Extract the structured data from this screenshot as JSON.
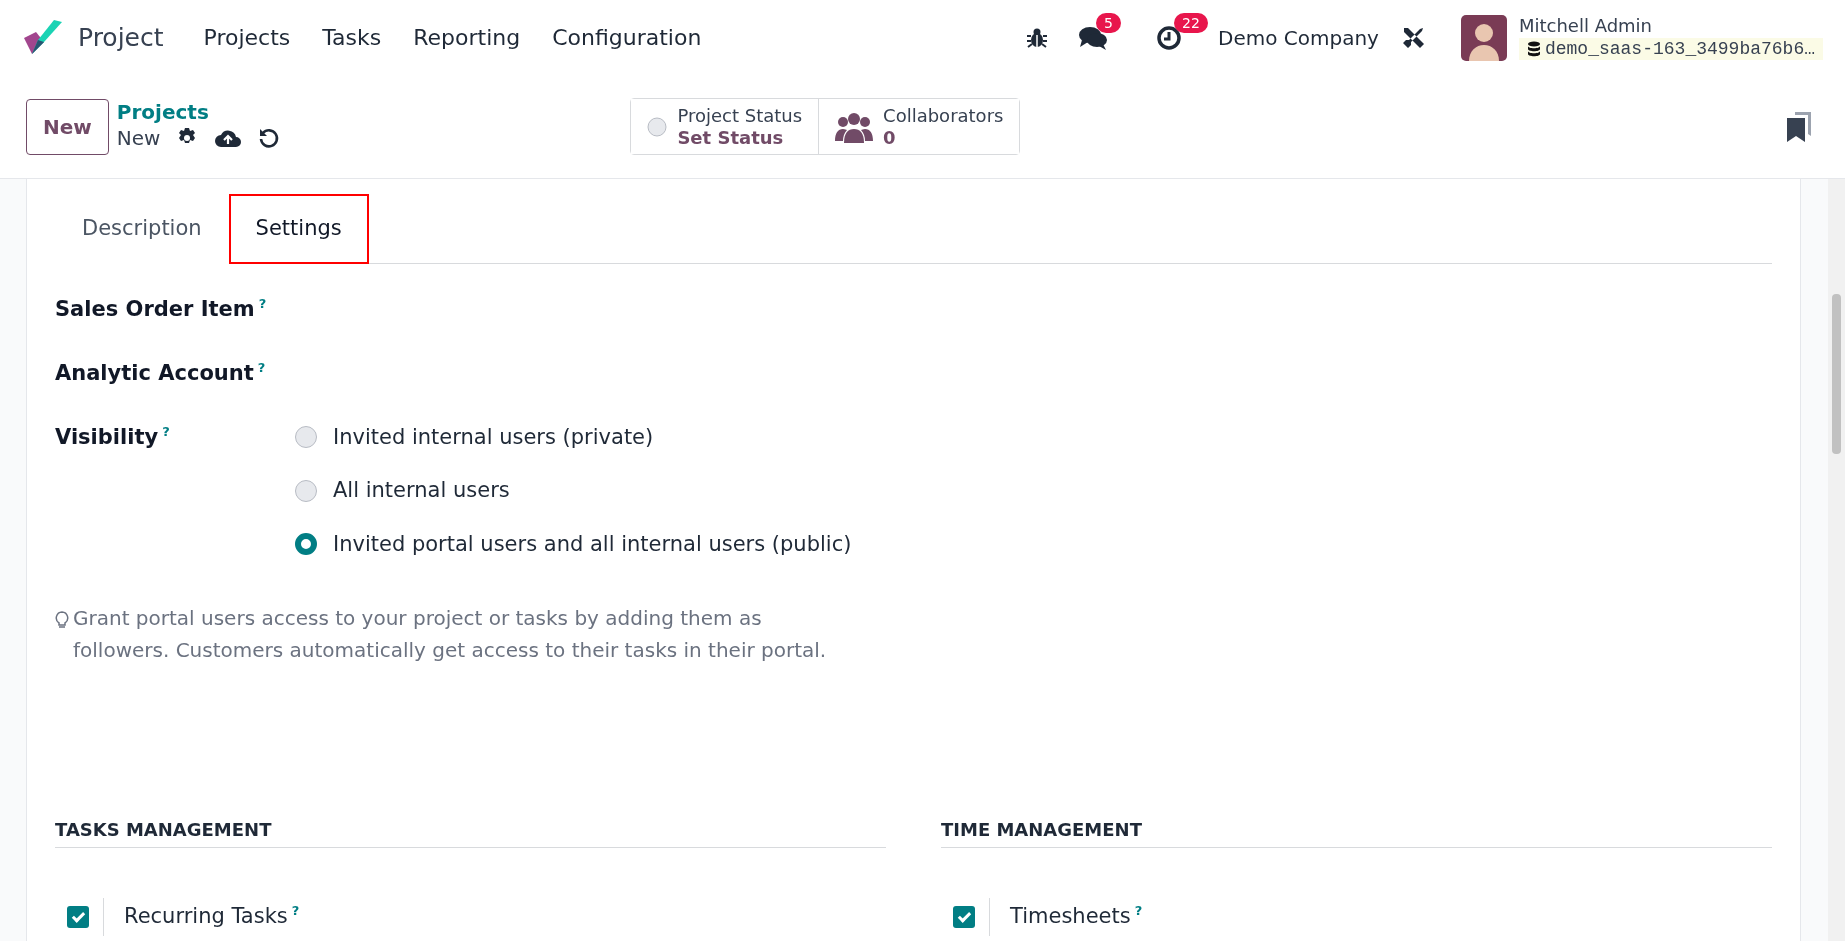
{
  "navbar": {
    "app_name": "Project",
    "menu": [
      {
        "label": "Projects"
      },
      {
        "label": "Tasks"
      },
      {
        "label": "Reporting"
      },
      {
        "label": "Configuration"
      }
    ],
    "messages_badge": "5",
    "activities_badge": "22",
    "company": "Demo Company",
    "user_name": "Mitchell Admin",
    "database": "demo_saas-163_3499ba76b6…"
  },
  "control_panel": {
    "new_button": "New",
    "breadcrumb_parent": "Projects",
    "breadcrumb_current": "New",
    "stat_buttons": [
      {
        "kind": "status",
        "label": "Project Status",
        "value": "Set Status"
      },
      {
        "kind": "collaborators",
        "label": "Collaborators",
        "value": "0"
      }
    ]
  },
  "tabs": [
    {
      "label": "Description",
      "selected": false,
      "highlighted": false
    },
    {
      "label": "Settings",
      "selected": true,
      "highlighted": true
    }
  ],
  "fields": [
    {
      "label": "Sales Order Item",
      "help": "?"
    },
    {
      "label": "Analytic Account",
      "help": "?"
    }
  ],
  "visibility": {
    "label": "Visibility",
    "help": "?",
    "options": [
      {
        "label": "Invited internal users (private)",
        "selected": false
      },
      {
        "label": "All internal users",
        "selected": false
      },
      {
        "label": "Invited portal users and all internal users (public)",
        "selected": true
      }
    ]
  },
  "hint": "Grant portal users access to your project or tasks by adding them as followers. Customers automatically get access to their tasks in their portal.",
  "sections": [
    {
      "title": "TASKS MANAGEMENT",
      "items": [
        {
          "label": "Recurring Tasks",
          "help": "?",
          "checked": true
        }
      ]
    },
    {
      "title": "TIME MANAGEMENT",
      "items": [
        {
          "label": "Timesheets",
          "help": "?",
          "checked": true
        }
      ]
    }
  ]
}
